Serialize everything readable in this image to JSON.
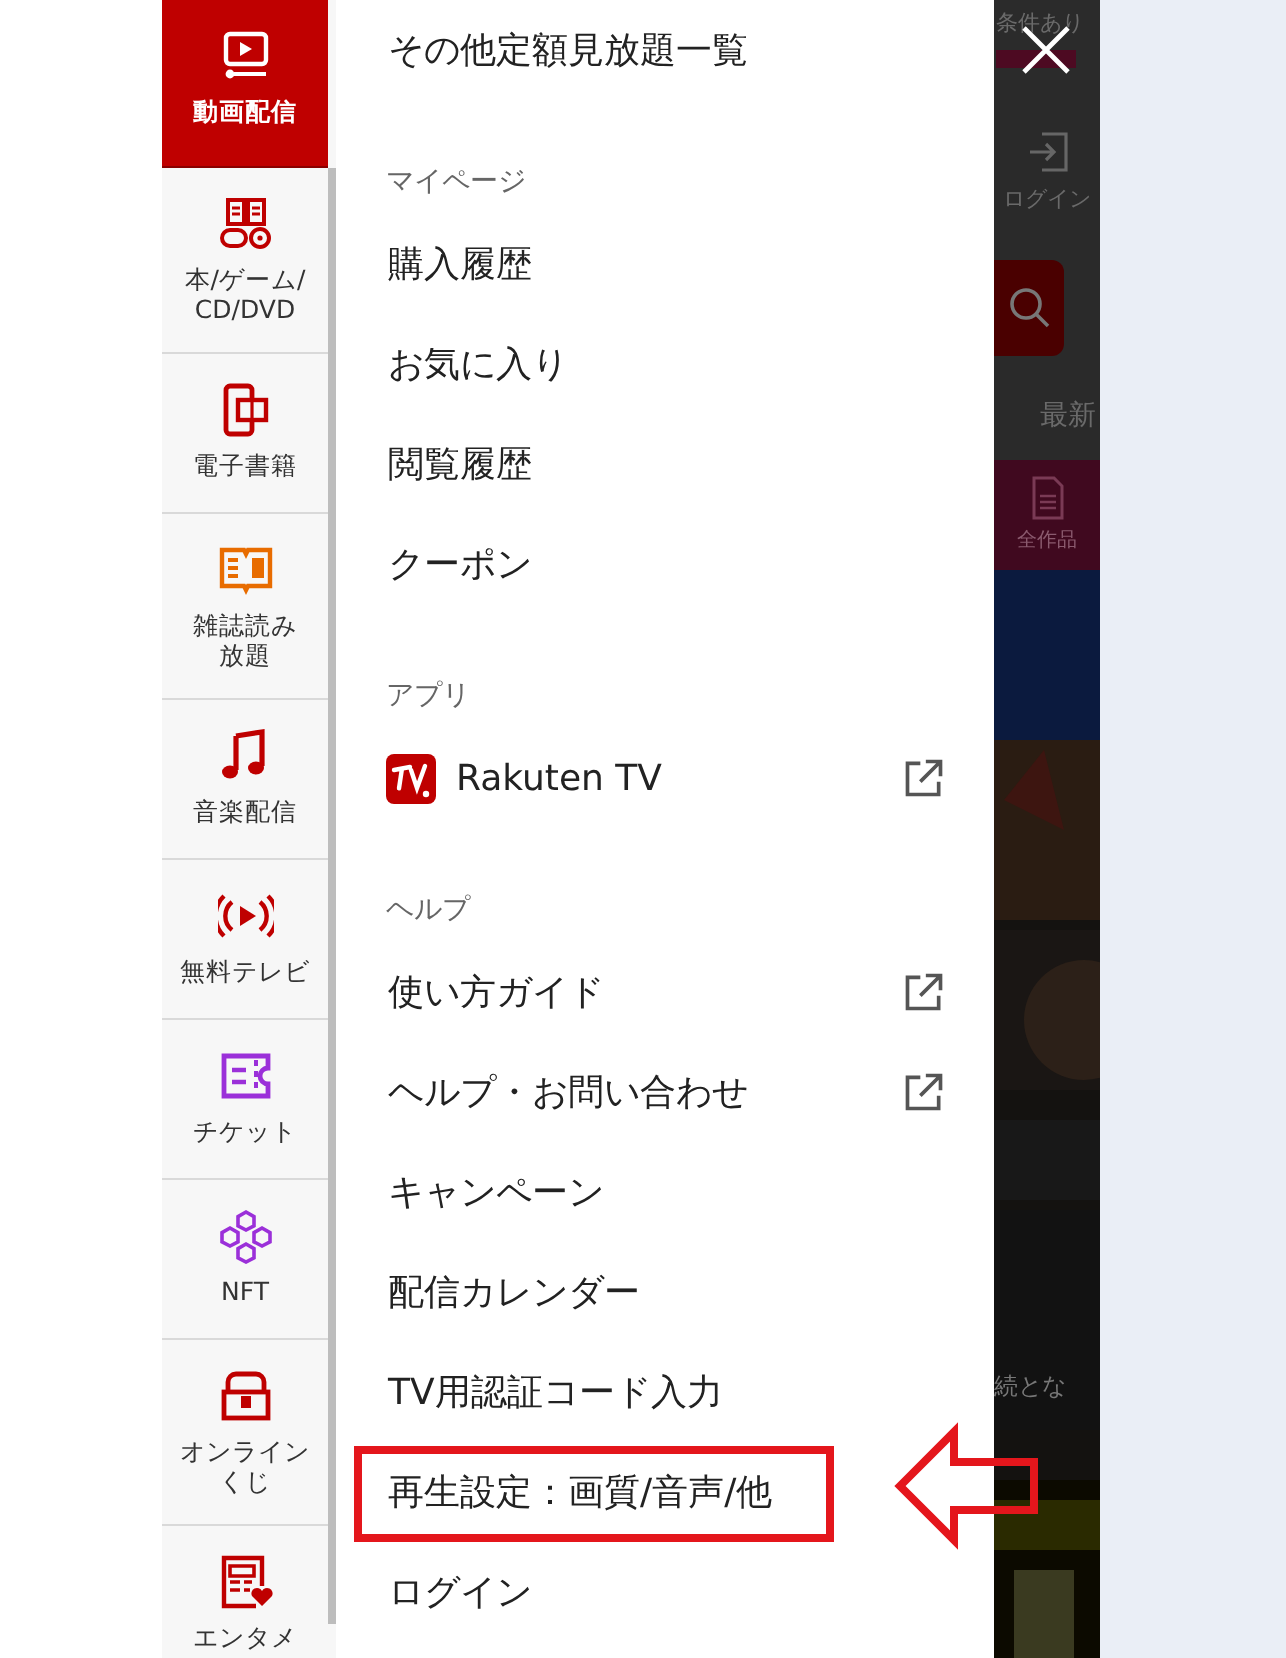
{
  "sidebar": {
    "items": [
      {
        "label": "動画配信",
        "selected": true
      },
      {
        "label": "本/ゲーム/\nCD/DVD",
        "selected": false
      },
      {
        "label": "電子書籍",
        "selected": false
      },
      {
        "label": "雑誌読み放題",
        "selected": false
      },
      {
        "label": "音楽配信",
        "selected": false
      },
      {
        "label": "無料テレビ",
        "selected": false
      },
      {
        "label": "チケット",
        "selected": false
      },
      {
        "label": "NFT",
        "selected": false
      },
      {
        "label": "オンラインくじ",
        "selected": false
      },
      {
        "label": "エンタメ",
        "selected": false
      }
    ]
  },
  "menu": {
    "items": [
      {
        "kind": "link",
        "label": "その他定額見放題一覧",
        "external": false,
        "highlighted": false
      },
      {
        "kind": "heading",
        "label": "マイページ"
      },
      {
        "kind": "link",
        "label": "購入履歴",
        "external": false,
        "highlighted": false
      },
      {
        "kind": "link",
        "label": "お気に入り",
        "external": false,
        "highlighted": false
      },
      {
        "kind": "link",
        "label": "閲覧履歴",
        "external": false,
        "highlighted": false
      },
      {
        "kind": "link",
        "label": "クーポン",
        "external": false,
        "highlighted": false
      },
      {
        "kind": "heading",
        "label": "アプリ"
      },
      {
        "kind": "app",
        "label": "Rakuten TV",
        "external": true,
        "highlighted": false
      },
      {
        "kind": "heading",
        "label": "ヘルプ"
      },
      {
        "kind": "link",
        "label": "使い方ガイド",
        "external": true,
        "highlighted": false
      },
      {
        "kind": "link",
        "label": "ヘルプ・お問い合わせ",
        "external": true,
        "highlighted": false
      },
      {
        "kind": "link",
        "label": "キャンペーン",
        "external": false,
        "highlighted": false
      },
      {
        "kind": "link",
        "label": "配信カレンダー",
        "external": false,
        "highlighted": false
      },
      {
        "kind": "link",
        "label": "TV用認証コード入力",
        "external": false,
        "highlighted": false
      },
      {
        "kind": "link",
        "label": "再生設定：画質/音声/他",
        "external": false,
        "highlighted": true
      },
      {
        "kind": "link",
        "label": "ログイン",
        "external": false,
        "highlighted": false
      }
    ]
  },
  "background_page": {
    "texts": [
      "条件あり",
      "ログイン",
      "最新",
      "全作品",
      "続とな"
    ]
  }
}
